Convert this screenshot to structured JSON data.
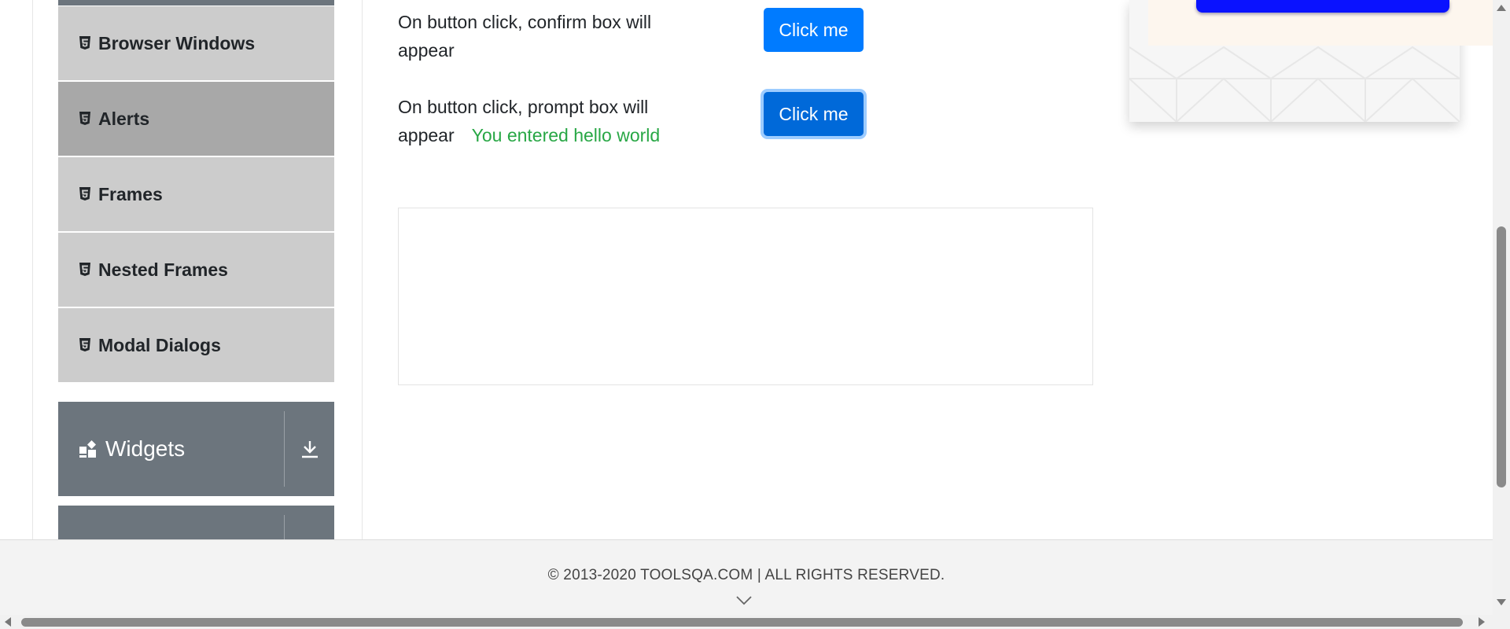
{
  "sidebar": {
    "items": [
      {
        "label": "Browser Windows",
        "icon": "html5-icon"
      },
      {
        "label": "Alerts",
        "icon": "html5-icon"
      },
      {
        "label": "Frames",
        "icon": "html5-icon"
      },
      {
        "label": "Nested Frames",
        "icon": "html5-icon"
      },
      {
        "label": "Modal Dialogs",
        "icon": "html5-icon"
      }
    ],
    "active_item": "Alerts",
    "groups": [
      {
        "label": "Widgets",
        "icon": "widgets-icon",
        "toggle_icon": "download-arrow-icon"
      }
    ]
  },
  "main": {
    "confirm_row": {
      "text": "On button click, confirm box will appear",
      "button_label": "Click me"
    },
    "prompt_row": {
      "text": "On button click, prompt box will appear",
      "button_label": "Click me",
      "result": "You entered hello world"
    }
  },
  "footer": {
    "text": "© 2013-2020 TOOLSQA.COM | ALL RIGHTS RESERVED."
  },
  "colors": {
    "primary_button": "#007bff",
    "result_text": "#28a745",
    "sidebar_item": "#cccccc",
    "sidebar_active": "#a8a8a8",
    "group_header": "#6c757d"
  }
}
